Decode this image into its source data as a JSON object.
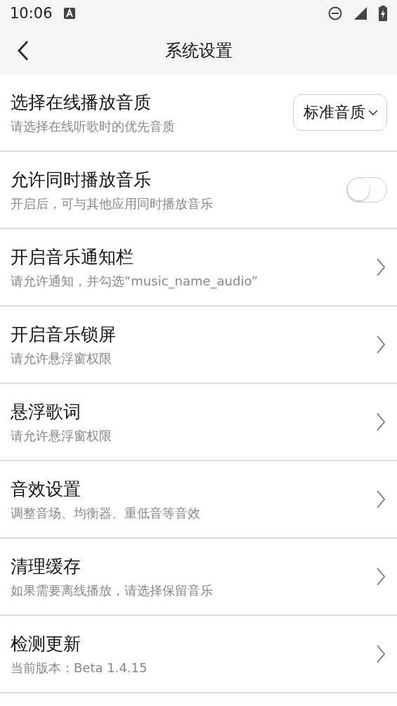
{
  "status_bar": {
    "time": "10:06"
  },
  "header": {
    "title": "系统设置"
  },
  "settings": [
    {
      "kind": "dropdown",
      "title": "选择在线播放音质",
      "subtitle": "请选择在线听歌时的优先音质",
      "value": "标准音质"
    },
    {
      "kind": "toggle",
      "title": "允许同时播放音乐",
      "subtitle": "开启后，可与其他应用同时播放音乐",
      "on": false
    },
    {
      "kind": "link",
      "title": "开启音乐通知栏",
      "subtitle": "请允许通知，并勾选“music_name_audio”"
    },
    {
      "kind": "link",
      "title": "开启音乐锁屏",
      "subtitle": "请允许悬浮窗权限"
    },
    {
      "kind": "link",
      "title": "悬浮歌词",
      "subtitle": "请允许悬浮窗权限"
    },
    {
      "kind": "link",
      "title": "音效设置",
      "subtitle": "调整音场、均衡器、重低音等音效"
    },
    {
      "kind": "link",
      "title": "清理缓存",
      "subtitle": "如果需要离线播放，请选择保留音乐"
    },
    {
      "kind": "link",
      "title": "检测更新",
      "subtitle": "当前版本：Beta 1.4.15"
    }
  ]
}
